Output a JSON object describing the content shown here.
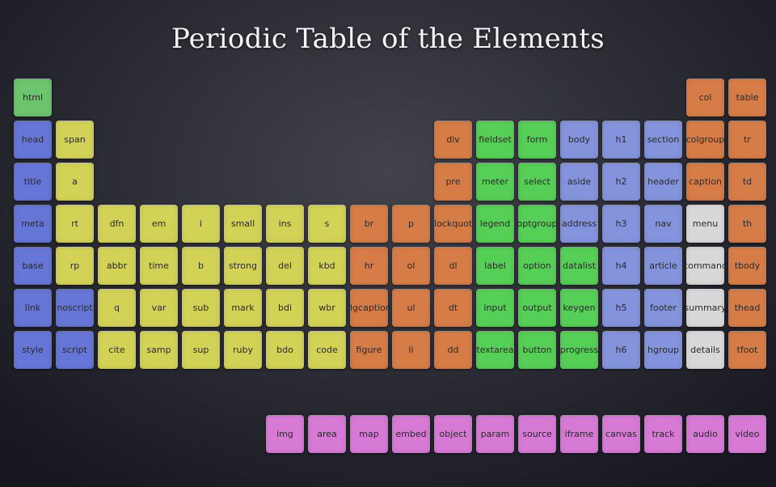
{
  "title": "Periodic Table of the Elements",
  "colors": {
    "root": "#6cc46c",
    "metadata": "#6676d6",
    "text": "#d2d257",
    "grouping": "#d67c47",
    "forms": "#56cf56",
    "sections": "#8393dc",
    "interactive": "#d8d8d8",
    "table": "#d67c47",
    "embedded": "#d67ad6"
  },
  "grid": [
    [
      {
        "t": "html",
        "c": "root"
      },
      null,
      null,
      null,
      null,
      null,
      null,
      null,
      null,
      null,
      null,
      null,
      null,
      null,
      null,
      null,
      {
        "t": "col",
        "c": "table"
      },
      {
        "t": "table",
        "c": "table"
      }
    ],
    [
      {
        "t": "head",
        "c": "metadata"
      },
      {
        "t": "span",
        "c": "text"
      },
      null,
      null,
      null,
      null,
      null,
      null,
      null,
      null,
      {
        "t": "div",
        "c": "grouping"
      },
      {
        "t": "fieldset",
        "c": "forms"
      },
      {
        "t": "form",
        "c": "forms"
      },
      {
        "t": "body",
        "c": "sections"
      },
      {
        "t": "h1",
        "c": "sections"
      },
      {
        "t": "section",
        "c": "sections"
      },
      {
        "t": "colgroup",
        "c": "table"
      },
      {
        "t": "tr",
        "c": "table"
      }
    ],
    [
      {
        "t": "title",
        "c": "metadata"
      },
      {
        "t": "a",
        "c": "text"
      },
      null,
      null,
      null,
      null,
      null,
      null,
      null,
      null,
      {
        "t": "pre",
        "c": "grouping"
      },
      {
        "t": "meter",
        "c": "forms"
      },
      {
        "t": "select",
        "c": "forms"
      },
      {
        "t": "aside",
        "c": "sections"
      },
      {
        "t": "h2",
        "c": "sections"
      },
      {
        "t": "header",
        "c": "sections"
      },
      {
        "t": "caption",
        "c": "table"
      },
      {
        "t": "td",
        "c": "table"
      }
    ],
    [
      {
        "t": "meta",
        "c": "metadata"
      },
      {
        "t": "rt",
        "c": "text"
      },
      {
        "t": "dfn",
        "c": "text"
      },
      {
        "t": "em",
        "c": "text"
      },
      {
        "t": "i",
        "c": "text"
      },
      {
        "t": "small",
        "c": "text"
      },
      {
        "t": "ins",
        "c": "text"
      },
      {
        "t": "s",
        "c": "text"
      },
      {
        "t": "br",
        "c": "grouping"
      },
      {
        "t": "p",
        "c": "grouping"
      },
      {
        "t": "blockquote",
        "c": "grouping"
      },
      {
        "t": "legend",
        "c": "forms"
      },
      {
        "t": "optgroup",
        "c": "forms"
      },
      {
        "t": "address",
        "c": "sections"
      },
      {
        "t": "h3",
        "c": "sections"
      },
      {
        "t": "nav",
        "c": "sections"
      },
      {
        "t": "menu",
        "c": "interactive"
      },
      {
        "t": "th",
        "c": "table"
      }
    ],
    [
      {
        "t": "base",
        "c": "metadata"
      },
      {
        "t": "rp",
        "c": "text"
      },
      {
        "t": "abbr",
        "c": "text"
      },
      {
        "t": "time",
        "c": "text"
      },
      {
        "t": "b",
        "c": "text"
      },
      {
        "t": "strong",
        "c": "text"
      },
      {
        "t": "del",
        "c": "text"
      },
      {
        "t": "kbd",
        "c": "text"
      },
      {
        "t": "hr",
        "c": "grouping"
      },
      {
        "t": "ol",
        "c": "grouping"
      },
      {
        "t": "dl",
        "c": "grouping"
      },
      {
        "t": "label",
        "c": "forms"
      },
      {
        "t": "option",
        "c": "forms"
      },
      {
        "t": "datalist",
        "c": "forms"
      },
      {
        "t": "h4",
        "c": "sections"
      },
      {
        "t": "article",
        "c": "sections"
      },
      {
        "t": "command",
        "c": "interactive"
      },
      {
        "t": "tbody",
        "c": "table"
      }
    ],
    [
      {
        "t": "link",
        "c": "metadata"
      },
      {
        "t": "noscript",
        "c": "metadata"
      },
      {
        "t": "q",
        "c": "text"
      },
      {
        "t": "var",
        "c": "text"
      },
      {
        "t": "sub",
        "c": "text"
      },
      {
        "t": "mark",
        "c": "text"
      },
      {
        "t": "bdi",
        "c": "text"
      },
      {
        "t": "wbr",
        "c": "text"
      },
      {
        "t": "figcaption",
        "c": "grouping"
      },
      {
        "t": "ul",
        "c": "grouping"
      },
      {
        "t": "dt",
        "c": "grouping"
      },
      {
        "t": "input",
        "c": "forms"
      },
      {
        "t": "output",
        "c": "forms"
      },
      {
        "t": "keygen",
        "c": "forms"
      },
      {
        "t": "h5",
        "c": "sections"
      },
      {
        "t": "footer",
        "c": "sections"
      },
      {
        "t": "summary",
        "c": "interactive"
      },
      {
        "t": "thead",
        "c": "table"
      }
    ],
    [
      {
        "t": "style",
        "c": "metadata"
      },
      {
        "t": "script",
        "c": "metadata"
      },
      {
        "t": "cite",
        "c": "text"
      },
      {
        "t": "samp",
        "c": "text"
      },
      {
        "t": "sup",
        "c": "text"
      },
      {
        "t": "ruby",
        "c": "text"
      },
      {
        "t": "bdo",
        "c": "text"
      },
      {
        "t": "code",
        "c": "text"
      },
      {
        "t": "figure",
        "c": "grouping"
      },
      {
        "t": "li",
        "c": "grouping"
      },
      {
        "t": "dd",
        "c": "grouping"
      },
      {
        "t": "textarea",
        "c": "forms"
      },
      {
        "t": "button",
        "c": "forms"
      },
      {
        "t": "progress",
        "c": "forms"
      },
      {
        "t": "h6",
        "c": "sections"
      },
      {
        "t": "hgroup",
        "c": "sections"
      },
      {
        "t": "details",
        "c": "interactive"
      },
      {
        "t": "tfoot",
        "c": "table"
      }
    ]
  ],
  "embedded_row": [
    null,
    null,
    null,
    null,
    null,
    null,
    {
      "t": "img",
      "c": "embedded"
    },
    {
      "t": "area",
      "c": "embedded"
    },
    {
      "t": "map",
      "c": "embedded"
    },
    {
      "t": "embed",
      "c": "embedded"
    },
    {
      "t": "object",
      "c": "embedded"
    },
    {
      "t": "param",
      "c": "embedded"
    },
    {
      "t": "source",
      "c": "embedded"
    },
    {
      "t": "iframe",
      "c": "embedded"
    },
    {
      "t": "canvas",
      "c": "embedded"
    },
    {
      "t": "track",
      "c": "embedded"
    },
    {
      "t": "audio",
      "c": "embedded"
    },
    {
      "t": "video",
      "c": "embedded"
    }
  ]
}
